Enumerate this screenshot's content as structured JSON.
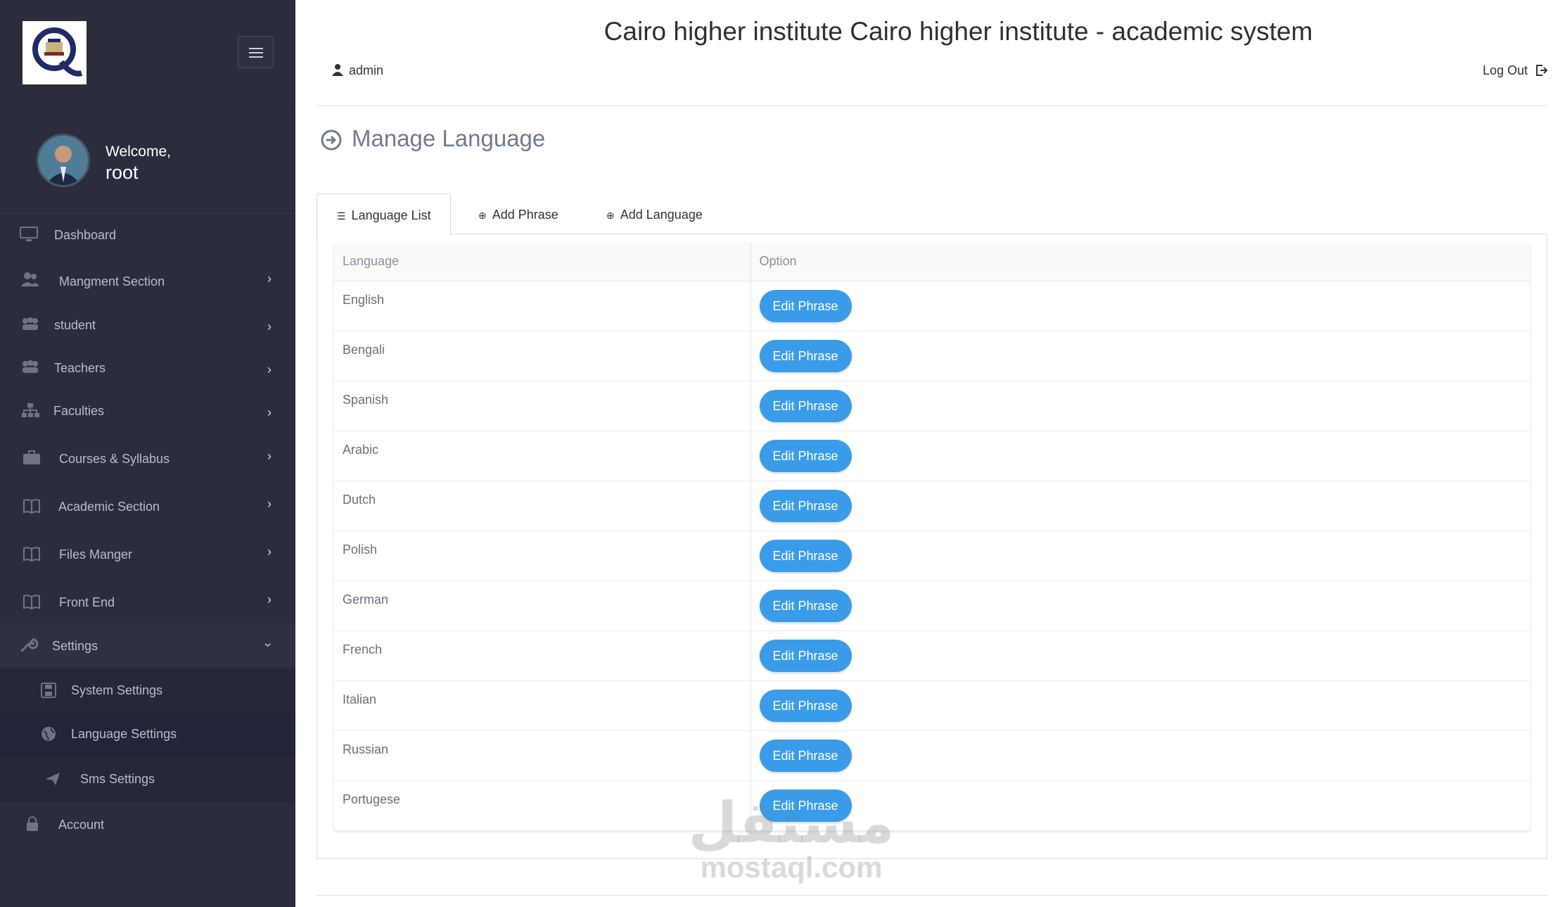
{
  "app": {
    "title": "Cairo higher institute Cairo higher institute - academic system",
    "user": "admin",
    "logout_label": "Log Out"
  },
  "sidebar": {
    "welcome": "Welcome,",
    "username": "root",
    "items": [
      {
        "label": "Dashboard",
        "icon": "monitor-icon"
      },
      {
        "label": "Mangment Section",
        "icon": "users-icon"
      },
      {
        "label": "student",
        "icon": "group-icon"
      },
      {
        "label": "Teachers",
        "icon": "group-icon"
      },
      {
        "label": "Faculties",
        "icon": "sitemap-icon"
      },
      {
        "label": "Courses & Syllabus",
        "icon": "briefcase-icon"
      },
      {
        "label": "Academic Section",
        "icon": "book-icon"
      },
      {
        "label": "Files Manger",
        "icon": "book-icon"
      },
      {
        "label": "Front End",
        "icon": "book-icon"
      },
      {
        "label": "Settings",
        "icon": "wrench-icon"
      }
    ],
    "settings_sub": [
      {
        "label": "System Settings",
        "icon": "save-icon"
      },
      {
        "label": "Language Settings",
        "icon": "globe-icon"
      },
      {
        "label": "Sms Settings",
        "icon": "paper-plane-icon"
      }
    ],
    "account": {
      "label": "Account",
      "icon": "lock-icon"
    }
  },
  "page": {
    "heading": "Manage Language",
    "tabs": [
      {
        "label": "Language List",
        "icon": "list-icon"
      },
      {
        "label": "Add Phrase",
        "icon": "plus-circle-icon"
      },
      {
        "label": "Add Language",
        "icon": "plus-circle-icon"
      }
    ]
  },
  "table": {
    "columns": [
      "Language",
      "Option"
    ],
    "button_label": "Edit Phrase",
    "rows": [
      "English",
      "Bengali",
      "Spanish",
      "Arabic",
      "Dutch",
      "Polish",
      "German",
      "French",
      "Italian",
      "Russian",
      "Portugese"
    ]
  },
  "watermark": {
    "arabic": "مستقل",
    "latin": "mostaql.com"
  },
  "colors": {
    "sidebar": "#2b2d3d",
    "button": "#3a9ce8"
  }
}
